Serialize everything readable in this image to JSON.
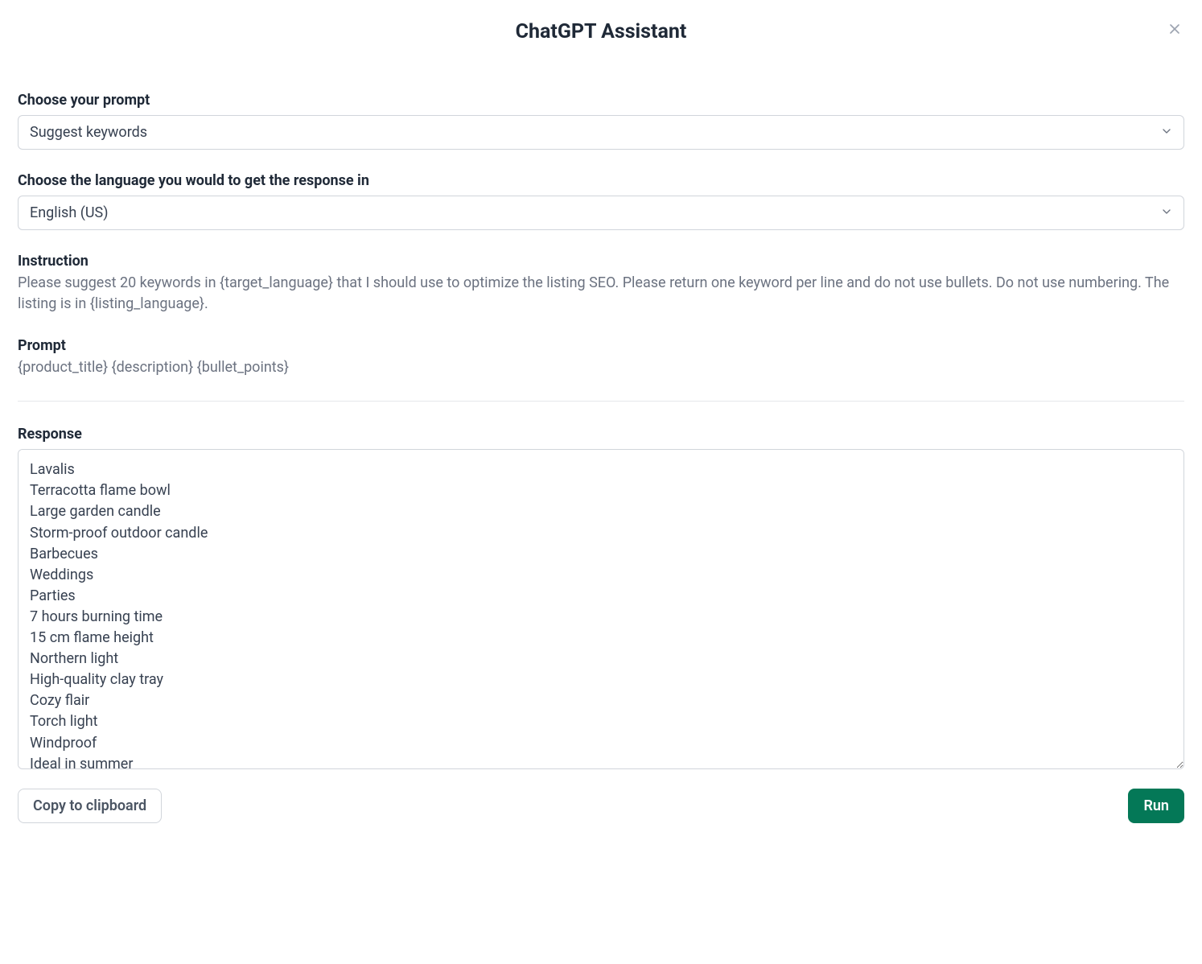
{
  "header": {
    "title": "ChatGPT Assistant"
  },
  "prompt_select": {
    "label": "Choose your prompt",
    "value": "Suggest keywords"
  },
  "language_select": {
    "label": "Choose the language you would to get the response in",
    "value": "English (US)"
  },
  "instruction": {
    "label": "Instruction",
    "text": "Please suggest 20 keywords in {target_language} that I should use to optimize the listing SEO. Please return one keyword per line and do not use bullets. Do not use numbering. The listing is in {listing_language}."
  },
  "prompt": {
    "label": "Prompt",
    "text": "{product_title} {description} {bullet_points}"
  },
  "response": {
    "label": "Response",
    "text": "Lavalis\nTerracotta flame bowl\nLarge garden candle\nStorm-proof outdoor candle\nBarbecues\nWeddings\nParties\n7 hours burning time\n15 cm flame height\nNorthern light\nHigh-quality clay tray\nCozy flair\nTorch light\nWindproof\nIdeal in summer"
  },
  "actions": {
    "copy": "Copy to clipboard",
    "run": "Run"
  }
}
